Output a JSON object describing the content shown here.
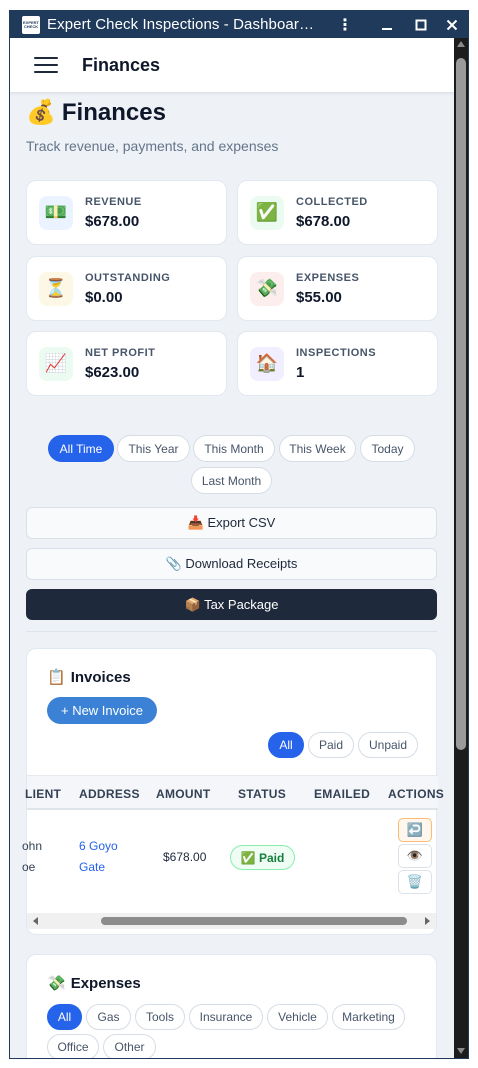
{
  "window": {
    "title": "Expert Check Inspections - Dashboard…",
    "logo_text": "EXPERT CHECK",
    "menu_icon": "⋮",
    "minimize_icon": "—",
    "maximize_icon": "☐",
    "close_icon": "✕"
  },
  "appbar": {
    "title": "Finances"
  },
  "page": {
    "title_emoji": "💰",
    "title": "Finances",
    "subtitle": "Track revenue, payments, and expenses"
  },
  "stats": [
    {
      "label": "REVENUE",
      "value": "$678.00",
      "icon": "💵",
      "icon_bg": "#eaf3ff"
    },
    {
      "label": "COLLECTED",
      "value": "$678.00",
      "icon": "✅",
      "icon_bg": "#ecfbf1"
    },
    {
      "label": "OUTSTANDING",
      "value": "$0.00",
      "icon": "⏳",
      "icon_bg": "#fdf8e6"
    },
    {
      "label": "EXPENSES",
      "value": "$55.00",
      "icon": "💸",
      "icon_bg": "#fdeeee"
    },
    {
      "label": "NET PROFIT",
      "value": "$623.00",
      "icon": "📈",
      "icon_bg": "#ecfbf1"
    },
    {
      "label": "INSPECTIONS",
      "value": "1",
      "icon": "🏠",
      "icon_bg": "#f1efff"
    }
  ],
  "periods": {
    "options": [
      "All Time",
      "This Year",
      "This Month",
      "This Week",
      "Today",
      "Last Month"
    ],
    "selected": "All Time"
  },
  "actions": {
    "export_csv": "📥 Export CSV",
    "download_receipts": "📎 Download Receipts",
    "tax_package": "📦 Tax Package"
  },
  "invoices": {
    "title_emoji": "📋",
    "title": "Invoices",
    "new_button": "+ New Invoice",
    "filters": [
      "All",
      "Paid",
      "Unpaid"
    ],
    "selected_filter": "All",
    "columns": [
      "LIENT",
      "ADDRESS",
      "AMOUNT",
      "STATUS",
      "EMAILED",
      "ACTIONS"
    ],
    "rows": [
      {
        "client_line1": "ohn",
        "client_line2": "oe",
        "address_line1": "6 Goyo",
        "address_line2": "Gate",
        "amount": "$678.00",
        "status": "✅ Paid",
        "emailed": "",
        "action_icons": [
          "↩️",
          "👁️",
          "🗑️"
        ]
      }
    ]
  },
  "expenses": {
    "title_emoji": "💸",
    "title": "Expenses",
    "categories": [
      "All",
      "Gas",
      "Tools",
      "Insurance",
      "Vehicle",
      "Marketing",
      "Office",
      "Other"
    ],
    "selected_category": "All"
  },
  "colors": {
    "titlebar": "#1f3a5a",
    "accent": "#2563eb",
    "dark_button": "#1e293b",
    "paid_green": "#15803d"
  }
}
